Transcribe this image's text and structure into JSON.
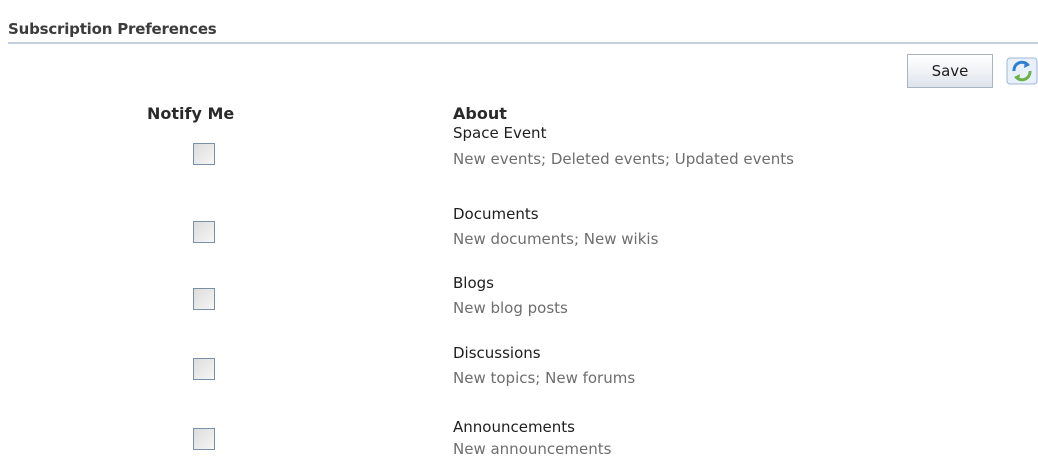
{
  "title": "Subscription Preferences",
  "toolbar": {
    "save_label": "Save",
    "refresh_icon": "refresh-icon"
  },
  "columns": {
    "notify": "Notify Me",
    "about": "About"
  },
  "items": [
    {
      "name": "Space Event",
      "description": "New events; Deleted events; Updated events",
      "checked": false
    },
    {
      "name": "Documents",
      "description": "New documents; New wikis",
      "checked": false
    },
    {
      "name": "Blogs",
      "description": "New blog posts",
      "checked": false
    },
    {
      "name": "Discussions",
      "description": "New topics; New forums",
      "checked": false
    },
    {
      "name": "Announcements",
      "description": "New announcements",
      "checked": false
    }
  ],
  "colors": {
    "rule": "#c5cde0",
    "description_text": "#6e6e6e",
    "checkbox_border": "#7b8fa6"
  }
}
